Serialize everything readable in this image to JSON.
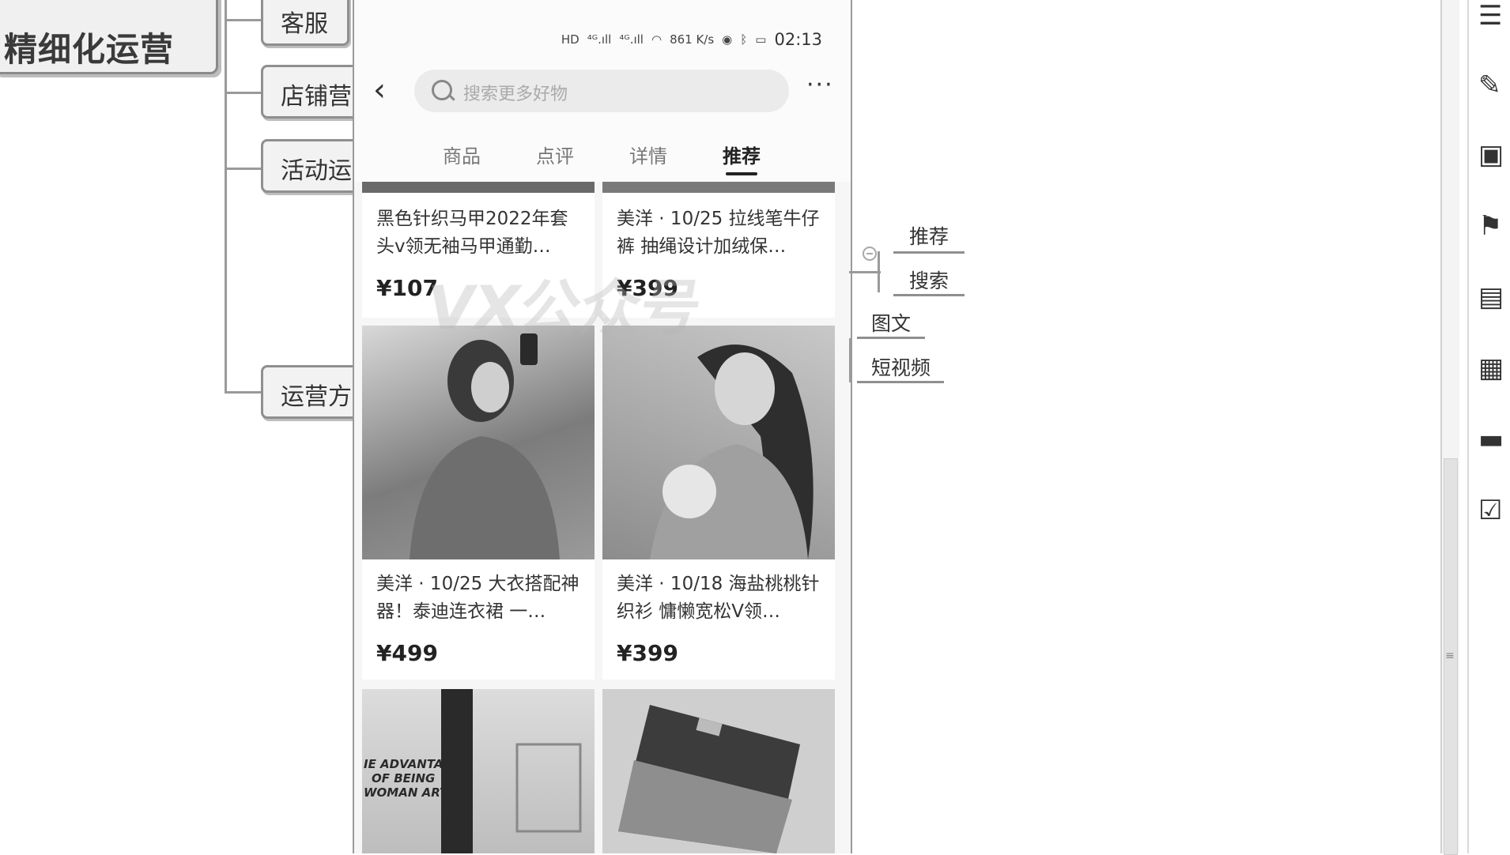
{
  "mindmap": {
    "root": "精细化运营",
    "left_branches": [
      "客服",
      "店铺营",
      "活动运",
      "运营方"
    ],
    "right_nodes": {
      "group1": [
        "推荐",
        "搜索"
      ],
      "standalone": [
        "图文",
        "短视频"
      ]
    }
  },
  "phone": {
    "status": {
      "signal1": "HD",
      "signal2": "⁴ᴳ.ıll",
      "signal3": "⁴ᴳ.ıll",
      "speed": "861 K/s",
      "time": "02:13"
    },
    "search_placeholder": "搜索更多好物",
    "tabs": [
      "商品",
      "点评",
      "详情",
      "推荐"
    ],
    "active_tab": "推荐",
    "watermark": "VX公众号",
    "products": [
      {
        "title": "黑色针织马甲2022年套头v领无袖马甲通勤…",
        "price": "¥107"
      },
      {
        "title": "美洋 · 10/25 拉线笔牛仔裤 抽绳设计加绒保…",
        "price": "¥399"
      },
      {
        "title": "美洋 · 10/25 大衣搭配神器！泰迪连衣裙 一…",
        "price": "¥499"
      },
      {
        "title": "美洋 · 10/18 海盐桃桃针织衫 慵懒宽松V领…",
        "price": "¥399"
      }
    ],
    "bottom_image_text": "IE ADVANTAGES OF BEING WOMAN ARTIST"
  },
  "colors": {
    "node_bg": "#f2f2f2",
    "node_border": "#8f8f8f",
    "phone_bg": "#f6f6f6"
  },
  "icons": {
    "rail": [
      "structure-icon",
      "tools-icon",
      "image-icon",
      "flag-icon",
      "text-icon",
      "notes-icon",
      "comment-icon",
      "task-icon"
    ]
  }
}
